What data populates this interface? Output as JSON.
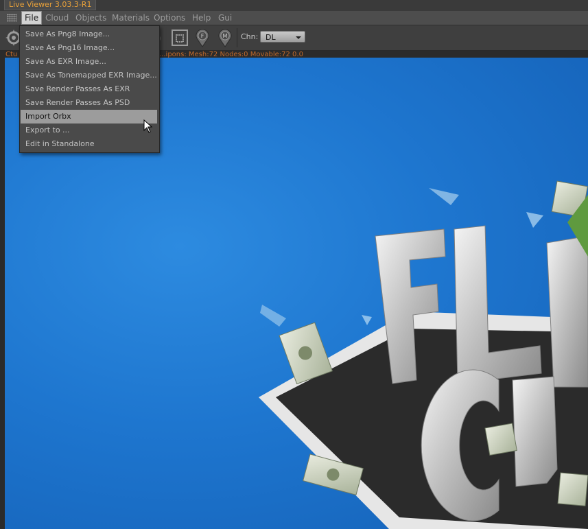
{
  "window": {
    "title": "Live Viewer 3.03.3-R1"
  },
  "menubar": {
    "items": [
      {
        "label": "File",
        "active": true
      },
      {
        "label": "Cloud"
      },
      {
        "label": "Objects"
      },
      {
        "label": "Materials"
      },
      {
        "label": "Options"
      },
      {
        "label": "Help"
      },
      {
        "label": "Gui"
      }
    ]
  },
  "toolbar": {
    "channel_label": "Chn:",
    "channel_value": "DL",
    "icons": [
      "render-settings-icon",
      "region-render-icon",
      "focus-pick-icon",
      "material-pick-icon"
    ],
    "icon_letters": {
      "focus": "F",
      "material": "M"
    }
  },
  "status": {
    "left": "Ctu",
    "text": "...ipons: Mesh:72 Nodes:0 Movable:72  0.0"
  },
  "file_menu": {
    "items": [
      "Save As Png8 Image...",
      "Save As Png16 Image...",
      "Save As EXR Image...",
      "Save As Tonemapped EXR Image...",
      "Save Render Passes As EXR",
      "Save Render Passes As PSD",
      "Import Orbx",
      "Export to ...",
      "Edit in Standalone"
    ],
    "hovered_index": 6
  },
  "colors": {
    "accent_title": "#e8a13a",
    "viewport_sky": "#1e76cf",
    "menu_bg": "#4a4a4a",
    "hover_bg": "#9c9c9c"
  }
}
